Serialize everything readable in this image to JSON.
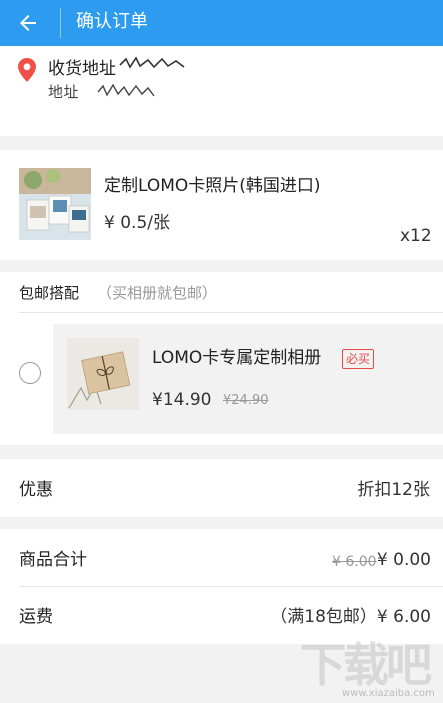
{
  "header": {
    "title": "确认订单",
    "back_icon": "arrow-left-icon"
  },
  "address": {
    "label": "收货地址",
    "detail": "地址"
  },
  "product": {
    "title": "定制LOMO卡照片(韩国进口)",
    "price": "¥ 0.5/张",
    "quantity": "x12"
  },
  "bundle": {
    "title": "包邮搭配",
    "note": "（买相册就包邮）",
    "item": {
      "name": "LOMO卡专属定制相册",
      "badge": "必买",
      "price": "¥14.90",
      "original_price": "¥24.90",
      "selected": false
    }
  },
  "discount": {
    "label": "优惠",
    "value": "折扣12张"
  },
  "totals": {
    "goods_label": "商品合计",
    "goods_original": "¥ 6.00",
    "goods_value": "¥ 0.00",
    "shipping_label": "运费",
    "shipping_value": "（满18包邮）¥ 6.00"
  },
  "watermark": {
    "text": "下载吧",
    "url": "www.xiazaiba.com"
  },
  "colors": {
    "primary": "#2d9cf0",
    "badge_red": "#e64a4a",
    "pin_red": "#f0504a"
  }
}
